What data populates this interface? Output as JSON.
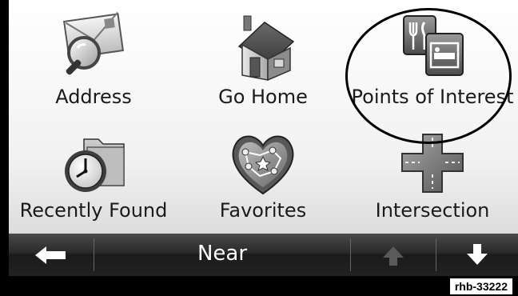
{
  "menu": {
    "items": [
      {
        "label": "Address",
        "icon": "address-magnifier-icon"
      },
      {
        "label": "Go Home",
        "icon": "house-icon"
      },
      {
        "label": "Points of Interest",
        "icon": "poi-fork-bed-icon"
      },
      {
        "label": "Recently Found",
        "icon": "clock-folder-icon"
      },
      {
        "label": "Favorites",
        "icon": "heart-map-icon"
      },
      {
        "label": "Intersection",
        "icon": "crossroad-icon"
      }
    ]
  },
  "toolbar": {
    "back_icon": "left-arrow-icon",
    "near_label": "Near",
    "scroll_up_icon": "up-arrow-icon",
    "scroll_down_icon": "down-arrow-icon"
  },
  "figure_code": "rhb-33222",
  "colors": {
    "toolbar": "#222222",
    "icon_gray": "#8a8a8a",
    "highlight_ring": "#000000"
  }
}
